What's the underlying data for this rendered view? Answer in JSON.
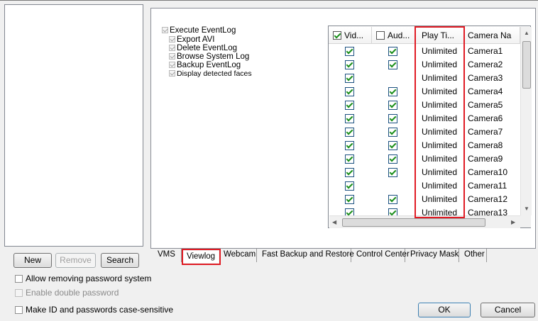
{
  "left_panel": {
    "buttons": {
      "new": "New",
      "remove": "Remove",
      "search": "Search"
    }
  },
  "options": {
    "allow_removing": "Allow removing password system",
    "enable_double": "Enable double password",
    "case_sensitive": "Make ID and passwords case-sensitive"
  },
  "permissions": [
    "Execute EventLog",
    "Export AVI",
    "Delete EventLog",
    "Browse System Log",
    "Backup EventLog",
    "Display detected faces"
  ],
  "grid": {
    "columns": [
      "Vid...",
      "Aud...",
      "Play Ti...",
      "Camera Na"
    ],
    "rows": [
      {
        "video": true,
        "audio": true,
        "play_time": "Unlimited",
        "camera": "Camera1"
      },
      {
        "video": true,
        "audio": true,
        "play_time": "Unlimited",
        "camera": "Camera2"
      },
      {
        "video": true,
        "audio": false,
        "play_time": "Unlimited",
        "camera": "Camera3"
      },
      {
        "video": true,
        "audio": true,
        "play_time": "Unlimited",
        "camera": "Camera4"
      },
      {
        "video": true,
        "audio": true,
        "play_time": "Unlimited",
        "camera": "Camera5"
      },
      {
        "video": true,
        "audio": true,
        "play_time": "Unlimited",
        "camera": "Camera6"
      },
      {
        "video": true,
        "audio": true,
        "play_time": "Unlimited",
        "camera": "Camera7"
      },
      {
        "video": true,
        "audio": true,
        "play_time": "Unlimited",
        "camera": "Camera8"
      },
      {
        "video": true,
        "audio": true,
        "play_time": "Unlimited",
        "camera": "Camera9"
      },
      {
        "video": true,
        "audio": true,
        "play_time": "Unlimited",
        "camera": "Camera10"
      },
      {
        "video": true,
        "audio": false,
        "play_time": "Unlimited",
        "camera": "Camera11"
      },
      {
        "video": true,
        "audio": true,
        "play_time": "Unlimited",
        "camera": "Camera12"
      },
      {
        "video": true,
        "audio": true,
        "play_time": "Unlimited",
        "camera": "Camera13"
      }
    ]
  },
  "tabs": [
    "VMS",
    "Viewlog",
    "Webcam",
    "Fast Backup and Restore",
    "Control Center",
    "Privacy Mask",
    "Other"
  ],
  "footer": {
    "ok": "OK",
    "cancel": "Cancel"
  },
  "colors": {
    "highlight": "#e01b24",
    "check": "#1b8f1b"
  }
}
